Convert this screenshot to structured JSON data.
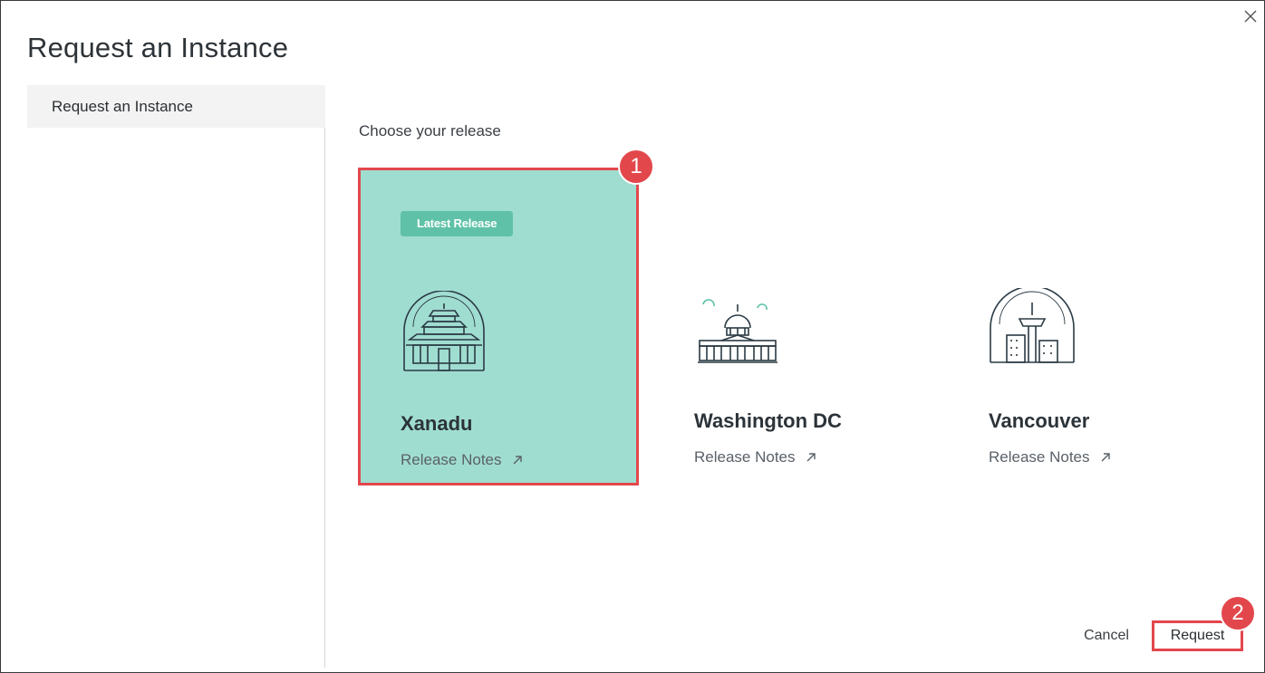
{
  "dialog": {
    "title": "Request an Instance",
    "close_icon": "close-icon"
  },
  "sidebar": {
    "items": [
      {
        "label": "Request an Instance",
        "active": true
      }
    ]
  },
  "main": {
    "section_label": "Choose your release",
    "releases": [
      {
        "name": "Xanadu",
        "badge": "Latest Release",
        "notes_label": "Release Notes",
        "icon": "xanadu-release-icon",
        "selected": true
      },
      {
        "name": "Washington DC",
        "notes_label": "Release Notes",
        "icon": "capitol-building-icon",
        "selected": false
      },
      {
        "name": "Vancouver",
        "notes_label": "Release Notes",
        "icon": "vancouver-release-icon",
        "selected": false
      }
    ],
    "external_link_icon": "external-link-icon"
  },
  "footer": {
    "cancel_label": "Cancel",
    "request_label": "Request"
  },
  "annotations": {
    "step1": "1",
    "step2": "2"
  },
  "colors": {
    "selected_card_bg": "#a0ddd1",
    "badge_bg": "#5fc2a8",
    "highlight_red": "#e2474c",
    "icon_stroke": "#2b3a44"
  }
}
